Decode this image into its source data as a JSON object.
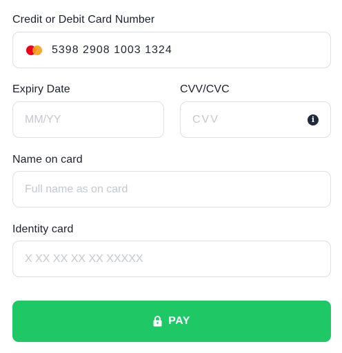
{
  "card_number": {
    "label": "Credit or Debit Card Number",
    "value": "5398 2908 1003 1324",
    "brand_icon": "mastercard-icon"
  },
  "expiry": {
    "label": "Expiry Date",
    "placeholder": "MM/YY"
  },
  "cvv": {
    "label": "CVV/CVC",
    "placeholder": "CVV",
    "info_icon": "info-icon"
  },
  "name": {
    "label": "Name on card",
    "placeholder": "Full name as on card"
  },
  "identity": {
    "label": "Identity card",
    "placeholder": "X XX XX XX XX XXXXX"
  },
  "pay_button": {
    "label": "PAY",
    "icon": "lock-icon"
  },
  "colors": {
    "primary": "#1ec865",
    "border": "#dcdfe4",
    "placeholder": "#c4c8cf",
    "text": "#1d212b"
  }
}
